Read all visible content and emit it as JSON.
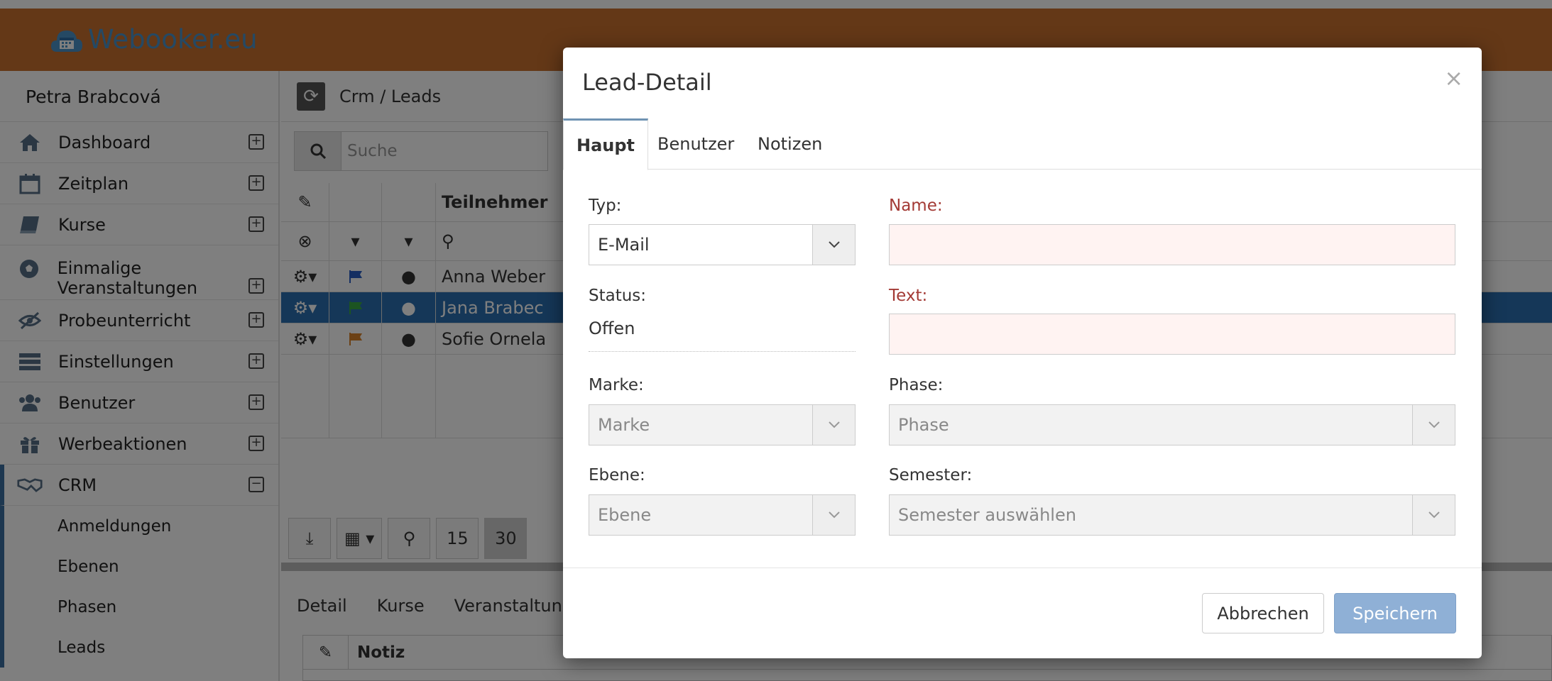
{
  "brand": {
    "name": "Webooker.eu"
  },
  "sidebar": {
    "user": "Petra Brabcová",
    "items": [
      {
        "label": "Dashboard"
      },
      {
        "label": "Zeitplan"
      },
      {
        "label": "Kurse"
      },
      {
        "label": "Einmalige Veranstaltungen"
      },
      {
        "label": "Probeunterricht"
      },
      {
        "label": "Einstellungen"
      },
      {
        "label": "Benutzer"
      },
      {
        "label": "Werbeaktionen"
      },
      {
        "label": "CRM"
      }
    ],
    "crm_sub": [
      {
        "label": "Anmeldungen"
      },
      {
        "label": "Ebenen"
      },
      {
        "label": "Phasen"
      },
      {
        "label": "Leads"
      }
    ]
  },
  "content": {
    "breadcrumb": "Crm / Leads",
    "search_placeholder": "Suche",
    "table": {
      "header": "Teilnehmer",
      "rows": [
        {
          "name": "Anna Weber",
          "flag": "#2a5fc4"
        },
        {
          "name": "Jana Brabec",
          "flag": "#39a845"
        },
        {
          "name": "Sofie Ornela",
          "flag": "#d9822b"
        }
      ]
    },
    "pager": {
      "size1": "15",
      "size2": "30"
    },
    "detail_tabs": [
      "Detail",
      "Kurse",
      "Veranstaltun"
    ],
    "notes_header": "Notiz"
  },
  "modal": {
    "title": "Lead-Detail",
    "close": "×",
    "tabs": [
      "Haupt",
      "Benutzer",
      "Notizen"
    ],
    "typ_label": "Typ:",
    "typ_value": "E-Mail",
    "name_label": "Name:",
    "status_label": "Status:",
    "status_value": "Offen",
    "text_label": "Text:",
    "marke_label": "Marke:",
    "marke_placeholder": "Marke",
    "phase_label": "Phase:",
    "phase_placeholder": "Phase",
    "ebene_label": "Ebene:",
    "ebene_placeholder": "Ebene",
    "semester_label": "Semester:",
    "semester_placeholder": "Semester auswählen",
    "cancel": "Abbrechen",
    "save": "Speichern"
  },
  "colors": {
    "header": "#c8702e",
    "brand": "#4a92c9",
    "selected_row": "#2a6fb0",
    "required": "#a33a35",
    "save_button": "#8fb0d6"
  }
}
